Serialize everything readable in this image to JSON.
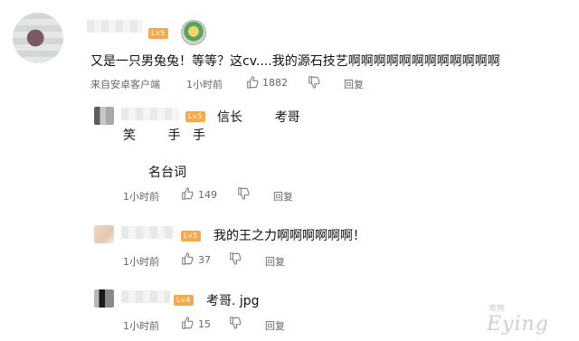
{
  "comment": {
    "level_badge": "Lv5",
    "text": "又是一只男兔兔！等等？这cv....我的源石技艺啊啊啊啊啊啊啊啊啊啊啊啊",
    "source": "来自安卓客户端",
    "time": "1小时前",
    "likes": "1882",
    "reply_label": "回复"
  },
  "replies": [
    {
      "level_badge": "Lv5",
      "line1": "信长        考哥",
      "line2": "笑        手   手",
      "line3": "名台词",
      "time": "1小时前",
      "likes": "149",
      "reply_label": "回复"
    },
    {
      "level_badge": "Lv5",
      "text": "我的王之力啊啊啊啊啊啊！",
      "time": "1小时前",
      "likes": "37",
      "reply_label": "回复"
    },
    {
      "level_badge": "Lv4",
      "text": "考哥. jpg",
      "time": "1小时前",
      "likes": "15",
      "reply_label": "回复"
    }
  ],
  "watermark": {
    "main": "Eying",
    "small": "寒舞"
  },
  "icons": [
    "thumbs-up-icon",
    "thumbs-down-icon",
    "level-badge-icon",
    "medal-icon"
  ]
}
